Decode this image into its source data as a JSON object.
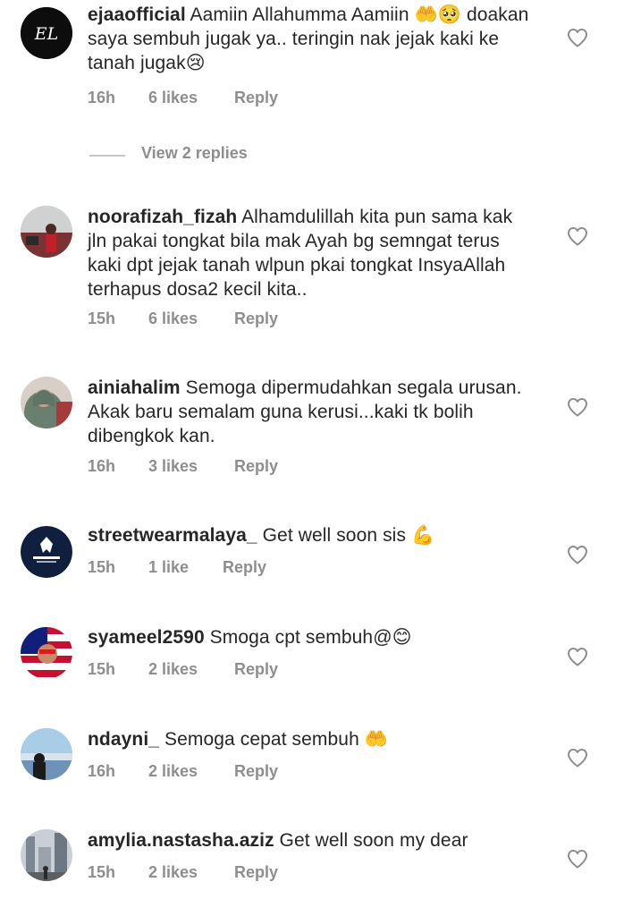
{
  "comments": [
    {
      "username": "ejaaofficial",
      "text": "Aamiin Allahumma Aamiin 🤲🥺 doakan saya sembuh jugak ya.. teringin nak jejak kaki ke tanah jugak😢",
      "time": "16h",
      "likes": "6 likes",
      "reply": "Reply",
      "avatar_text": "EL"
    },
    {
      "username": "noorafizah_fizah",
      "text": "Alhamdulillah kita pun sama kak jln pakai tongkat bila mak Ayah bg semngat terus kaki dpt jejak tanah wlpun pkai tongkat InsyaAllah terhapus dosa2 kecil kita..",
      "time": "15h",
      "likes": "6 likes",
      "reply": "Reply"
    },
    {
      "username": "ainiahalim",
      "text": "Semoga dipermudahkan segala urusan. Akak baru semalam guna kerusi...kaki tk bolih dibengkok kan.",
      "time": "16h",
      "likes": "3 likes",
      "reply": "Reply"
    },
    {
      "username": "streetwearmalaya_",
      "text": "Get well soon sis 💪",
      "time": "15h",
      "likes": "1 like",
      "reply": "Reply"
    },
    {
      "username": "syameel2590",
      "text": "Smoga cpt sembuh@😊",
      "time": "15h",
      "likes": "2 likes",
      "reply": "Reply"
    },
    {
      "username": "ndayni_",
      "text": "Semoga cepat sembuh 🤲",
      "time": "16h",
      "likes": "2 likes",
      "reply": "Reply"
    },
    {
      "username": "amylia.nastasha.aziz",
      "text": "Get well soon my dear",
      "time": "15h",
      "likes": "2 likes",
      "reply": "Reply"
    }
  ],
  "view_replies": "View 2 replies",
  "colors": {
    "text": "#262626",
    "meta": "#8e8e8e",
    "heart": "#8e8e8e"
  }
}
